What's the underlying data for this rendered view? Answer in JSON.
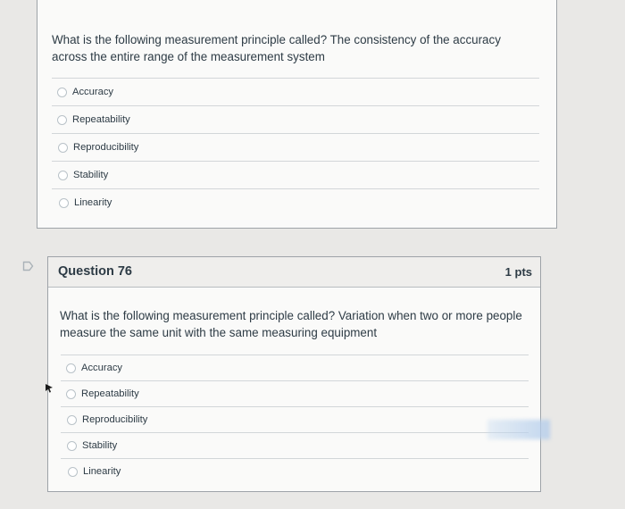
{
  "previous_question": {
    "text": "What is the following measurement principle called? The consistency of the accuracy across the entire range of the measurement system",
    "answers": [
      "Accuracy",
      "Repeatability",
      "Reproducibility",
      "Stability",
      "Linearity"
    ]
  },
  "question_76": {
    "title": "Question 76",
    "points": "1 pts",
    "text": "What is the following measurement principle called? Variation when two or more people measure the same unit with the same measuring equipment",
    "answers": [
      "Accuracy",
      "Repeatability",
      "Reproducibility",
      "Stability",
      "Linearity"
    ]
  },
  "icons": {
    "flag": "flag-question-icon",
    "radio": "radio-button-icon",
    "cursor": "mouse-pointer-icon"
  },
  "colors": {
    "text": "#2d3b45",
    "background": "#e9e8e6",
    "card": "#fafaf9",
    "header": "#efeeec"
  }
}
